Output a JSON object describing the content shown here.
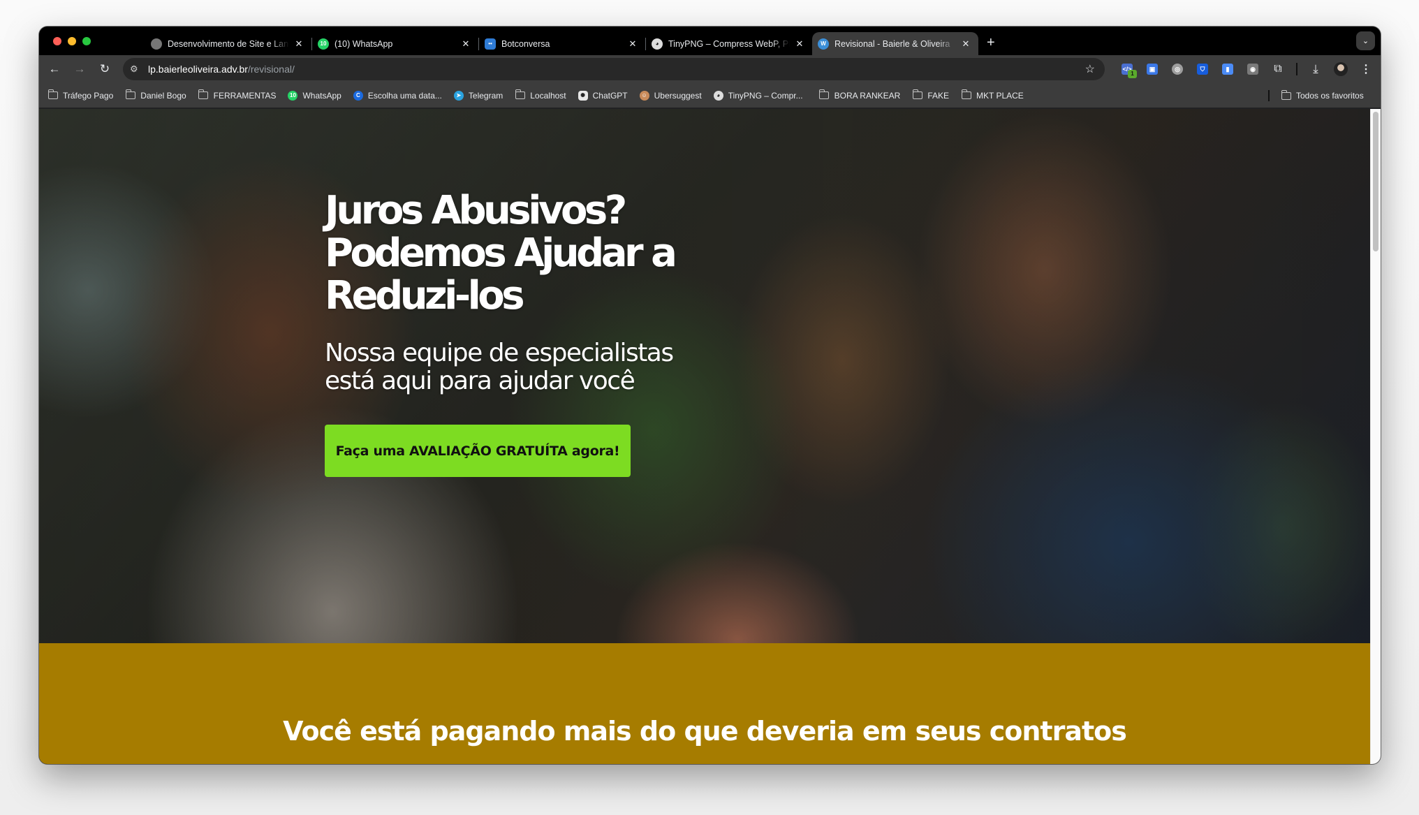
{
  "browser": {
    "tabs": [
      {
        "title": "Desenvolvimento de Site e Landing Page",
        "icon": "person-avatar-icon",
        "icon_color": "#888888",
        "active": false
      },
      {
        "title": "(10) WhatsApp",
        "icon": "whatsapp-icon",
        "icon_badge": "10",
        "icon_color": "#25d366",
        "active": false
      },
      {
        "title": "Botconversa",
        "icon": "botconversa-icon",
        "icon_color": "#2f7cd6",
        "active": false
      },
      {
        "title": "TinyPNG – Compress WebP, PNG and JPEG",
        "icon": "panda-icon",
        "icon_color": "#dddddd",
        "active": false
      },
      {
        "title": "Revisional - Baierle & Oliveira",
        "icon": "wordpress-icon",
        "icon_color": "#3b8fd8",
        "active": true
      }
    ],
    "new_tab_label": "+",
    "tab_search_label": "⌄",
    "url": {
      "host": "lp.baierleoliveira.adv.br",
      "path": "/revisional/"
    },
    "extensions": [
      {
        "name": "dev-tools-extension",
        "glyph": "</>",
        "color": "#4a6fd1",
        "badge": "1"
      },
      {
        "name": "tag-extension",
        "glyph": "▣",
        "color": "#3b78e7"
      },
      {
        "name": "circle-extension",
        "glyph": "◎",
        "color": "#9e9e9e"
      },
      {
        "name": "bitwarden-extension",
        "glyph": "⛉",
        "color": "#175ddc"
      },
      {
        "name": "docs-extension",
        "glyph": "▮",
        "color": "#4b8bf5"
      },
      {
        "name": "camera-extension",
        "glyph": "◉",
        "color": "#7a7a7a"
      }
    ],
    "bookmarks": [
      {
        "label": "Tráfego Pago",
        "type": "folder"
      },
      {
        "label": "Daniel Bogo",
        "type": "folder"
      },
      {
        "label": "FERRAMENTAS",
        "type": "folder"
      },
      {
        "label": "WhatsApp",
        "type": "site",
        "icon": "whatsapp-icon",
        "icon_text": "10",
        "color": "#25d366"
      },
      {
        "label": "Escolha uma data...",
        "type": "site",
        "icon": "calendly-icon",
        "icon_text": "C",
        "color": "#1a6ae0"
      },
      {
        "label": "Telegram",
        "type": "site",
        "icon": "telegram-icon",
        "icon_text": "➤",
        "color": "#2aa3e0"
      },
      {
        "label": "Localhost",
        "type": "folder"
      },
      {
        "label": "ChatGPT",
        "type": "site",
        "icon": "chatgpt-icon",
        "icon_text": "✺",
        "color": "#e8e8e8"
      },
      {
        "label": "Ubersuggest",
        "type": "site",
        "icon": "ubersuggest-icon",
        "icon_text": "☺",
        "color": "#c98b5a"
      },
      {
        "label": "TinyPNG – Compr...",
        "type": "site",
        "icon": "panda-icon",
        "icon_text": "◕",
        "color": "#dddddd"
      },
      {
        "label": "BORA RANKEAR",
        "type": "folder"
      },
      {
        "label": "FAKE",
        "type": "folder"
      },
      {
        "label": "MKT PLACE",
        "type": "folder"
      }
    ],
    "all_bookmarks_label": "Todos os favoritos"
  },
  "page": {
    "hero": {
      "title": "Juros Abusivos? Podemos Ajudar a Reduzi-los",
      "subtitle": "Nossa equipe de especialistas está aqui para ajudar você",
      "cta_label": "Faça uma AVALIAÇÃO GRATUÍTA agora!",
      "cta_color": "#7ddc22"
    },
    "section2": {
      "heading": "Você está pagando mais do que deveria em seus contratos",
      "background_color": "#a67c00"
    }
  }
}
